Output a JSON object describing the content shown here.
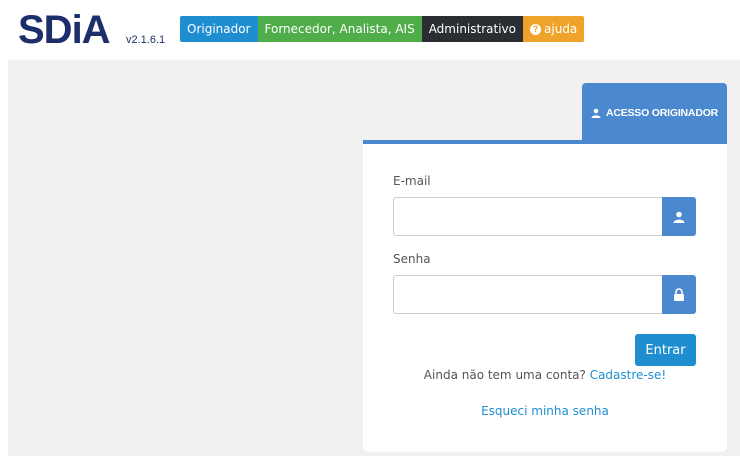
{
  "header": {
    "logo_text": "SDiA",
    "version": "v2.1.6.1",
    "nav": {
      "originador": "Originador",
      "fornecedor": "Fornecedor, Analista, AIS",
      "administrativo": "Administrativo",
      "ajuda": "ajuda"
    }
  },
  "login": {
    "tab_label": "ACESSO ORIGINADOR",
    "email_label": "E-mail",
    "email_value": "",
    "password_label": "Senha",
    "password_value": "",
    "submit_label": "Entrar",
    "signup_prompt": "Ainda não tem uma conta?",
    "signup_link": "Cadastre-se!",
    "forgot_link": "Esqueci minha senha"
  },
  "icons": {
    "tab": "user-icon",
    "email": "user-icon",
    "password": "lock-icon",
    "help": "question-circle-icon"
  },
  "colors": {
    "brand_dark": "#1d2f6b",
    "primary": "#1e8ed0",
    "panel_blue": "#4a88cf",
    "green": "#4fae4a",
    "dark": "#2b2f33",
    "orange": "#f0a32a",
    "background": "#f1f1f1"
  }
}
